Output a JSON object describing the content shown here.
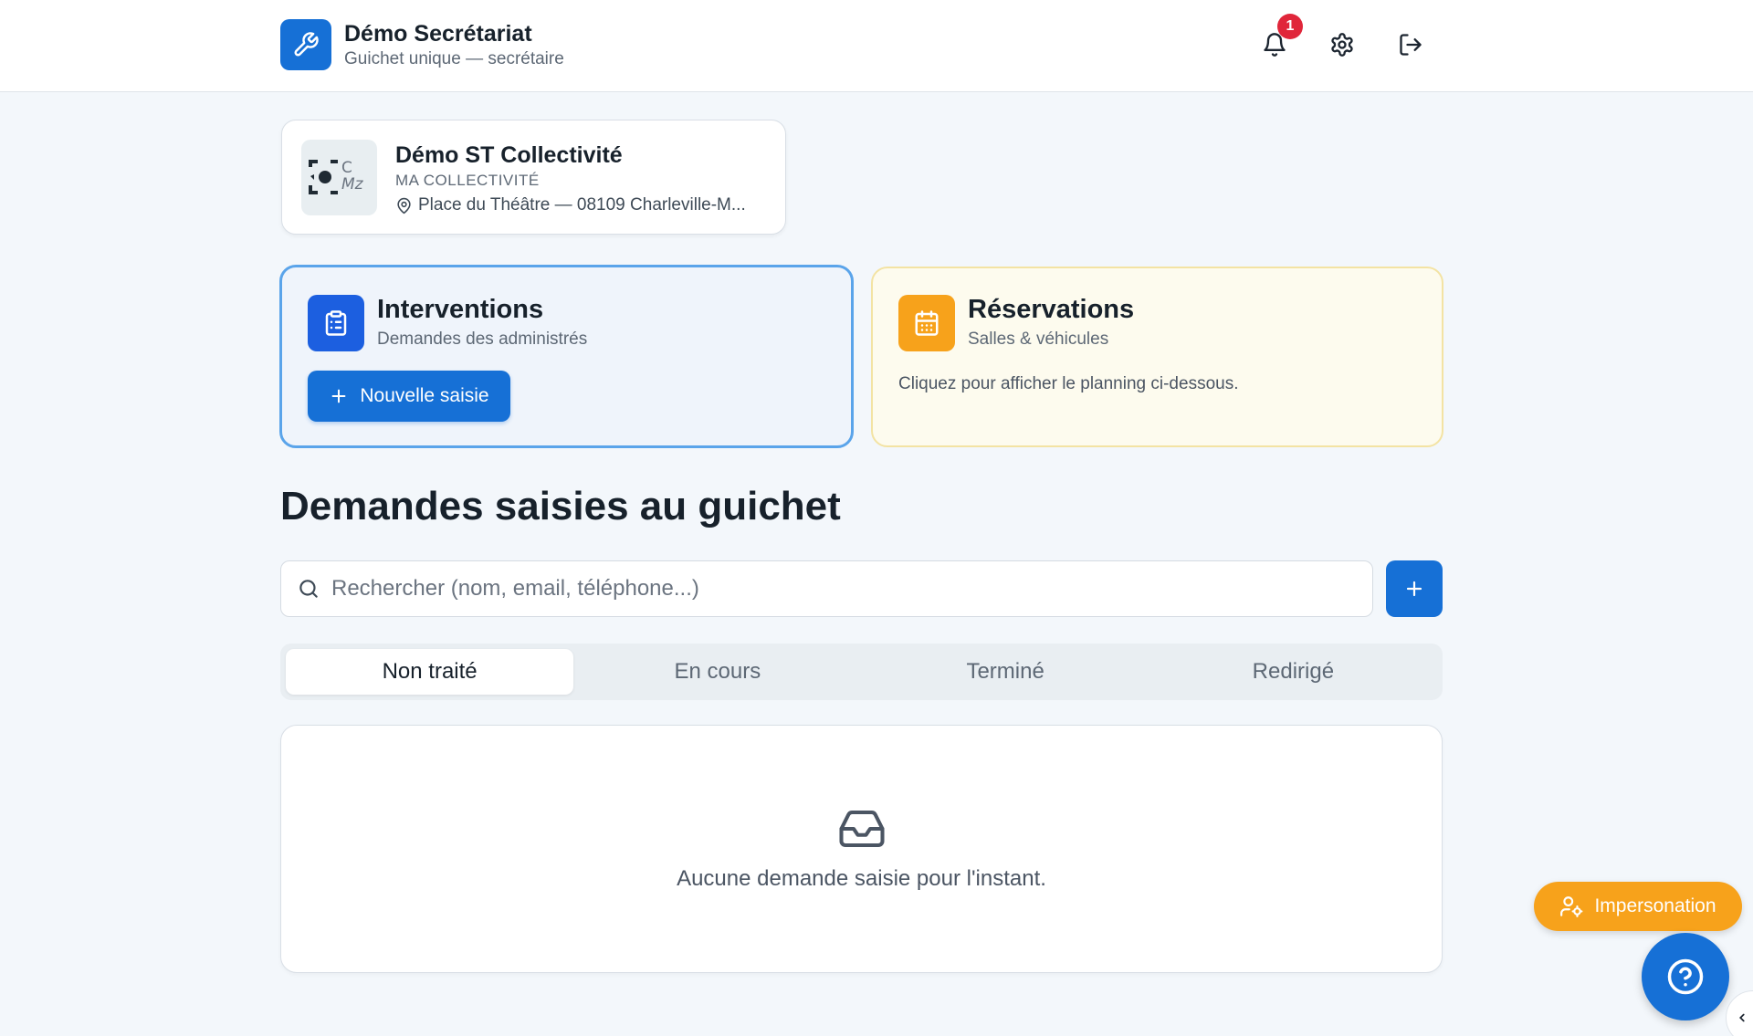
{
  "header": {
    "app_title": "Démo Secrétariat",
    "app_subtitle": "Guichet unique — secrétaire",
    "logo_icon": "wrench-icon",
    "notifications_count": "1",
    "icons": [
      "bell-icon",
      "gear-icon",
      "logout-icon"
    ]
  },
  "collectivity": {
    "name": "Démo ST Collectivité",
    "type": "MA COLLECTIVITÉ",
    "address": "Place du Théâtre — 08109 Charleville-M...",
    "logo_text": "C Mz"
  },
  "modules": {
    "interventions": {
      "title": "Interventions",
      "subtitle": "Demandes des administrés",
      "button_label": "Nouvelle saisie",
      "icon": "clipboard-list-icon",
      "color": "#1c5fe0"
    },
    "reservations": {
      "title": "Réservations",
      "subtitle": "Salles & véhicules",
      "hint": "Cliquez pour afficher le planning ci-dessous.",
      "icon": "calendar-icon",
      "color": "#f7a21b"
    }
  },
  "requests": {
    "section_title": "Demandes saisies au guichet",
    "search_placeholder": "Rechercher (nom, email, téléphone...)",
    "tabs": [
      {
        "label": "Non traité",
        "active": true
      },
      {
        "label": "En cours",
        "active": false
      },
      {
        "label": "Terminé",
        "active": false
      },
      {
        "label": "Redirigé",
        "active": false
      }
    ],
    "empty_message": "Aucune demande saisie pour l'instant.",
    "empty_icon": "inbox-icon"
  },
  "floating": {
    "impersonation_label": "Impersonation",
    "help_icon": "help-circle-icon"
  },
  "colors": {
    "primary": "#1670d6",
    "accent_orange": "#f7a21b",
    "badge_red": "#e0263a"
  }
}
